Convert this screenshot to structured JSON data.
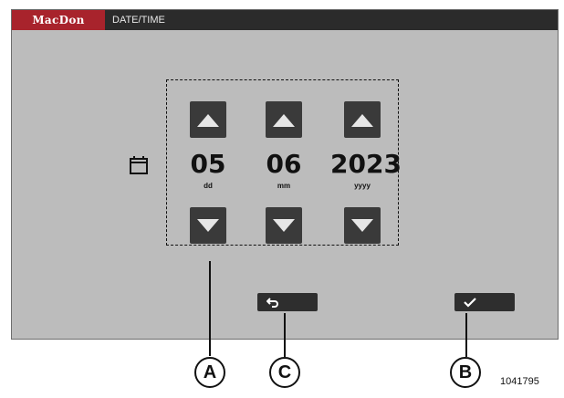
{
  "header": {
    "logo": "MacDon",
    "title": "DATE/TIME"
  },
  "picker": {
    "day": {
      "value": "05",
      "unit": "dd"
    },
    "month": {
      "value": "06",
      "unit": "mm"
    },
    "year": {
      "value": "2023",
      "unit": "yyyy"
    }
  },
  "callouts": {
    "a": "A",
    "b": "B",
    "c": "C"
  },
  "figure_id": "1041795",
  "colors": {
    "brand": "#a8232c",
    "titlebar": "#2b2b2b",
    "screen": "#bcbcbc",
    "button": "#3a3a3a"
  }
}
